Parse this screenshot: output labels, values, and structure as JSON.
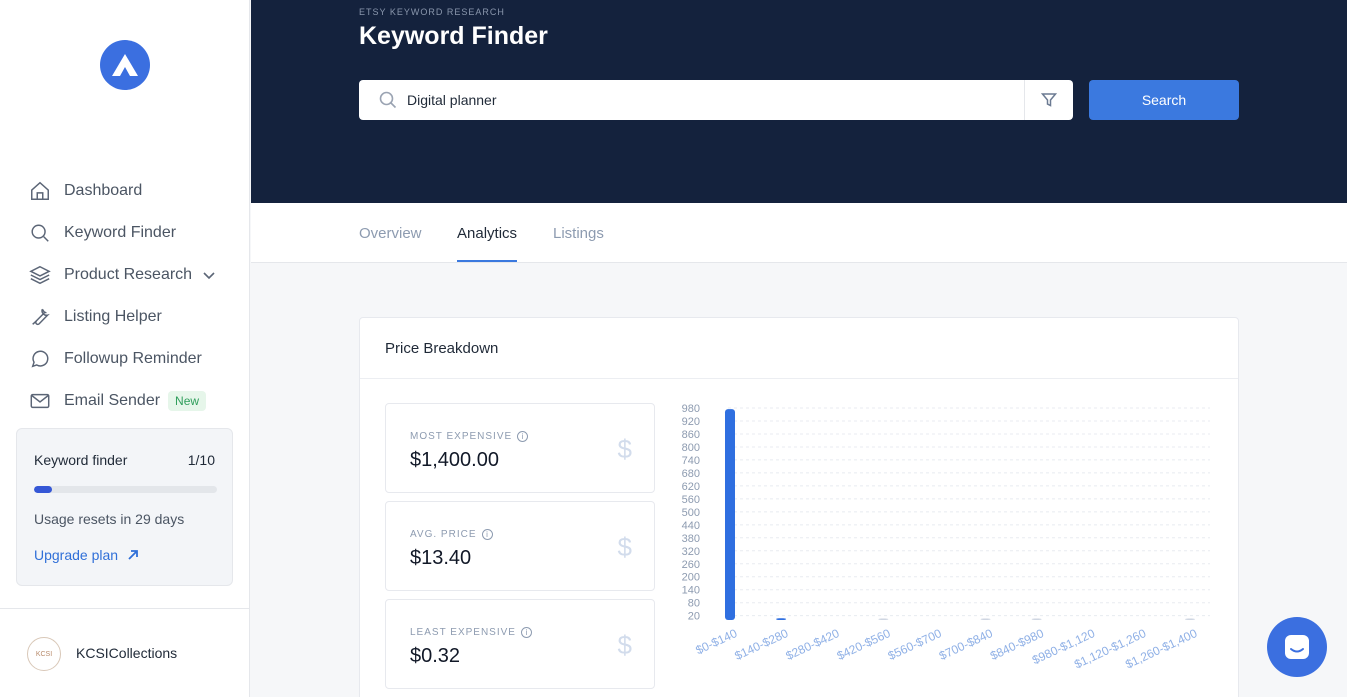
{
  "sidebar": {
    "items": [
      {
        "label": "Dashboard",
        "icon": "home-icon"
      },
      {
        "label": "Keyword Finder",
        "icon": "search-icon"
      },
      {
        "label": "Product Research",
        "icon": "layers-icon"
      },
      {
        "label": "Listing Helper",
        "icon": "wrench-icon"
      },
      {
        "label": "Followup Reminder",
        "icon": "chat-icon"
      },
      {
        "label": "Email Sender",
        "icon": "mail-icon",
        "badge": "New"
      }
    ],
    "usage": {
      "title": "Keyword finder",
      "count": "1/10",
      "progress": 0.1,
      "reset_text": "Usage resets in 29 days",
      "upgrade_label": "Upgrade plan"
    },
    "account": {
      "name": "KCSICollections",
      "avatar_text": "KCSI"
    }
  },
  "header": {
    "eyebrow": "ETSY KEYWORD RESEARCH",
    "title": "Keyword Finder",
    "search_value": "Digital planner",
    "search_button": "Search"
  },
  "tabs": [
    {
      "label": "Overview",
      "active": false
    },
    {
      "label": "Analytics",
      "active": true
    },
    {
      "label": "Listings",
      "active": false
    }
  ],
  "card": {
    "title": "Price Breakdown",
    "stats": [
      {
        "label": "MOST EXPENSIVE",
        "value": "$1,400.00"
      },
      {
        "label": "AVG. PRICE",
        "value": "$13.40"
      },
      {
        "label": "LEAST EXPENSIVE",
        "value": "$0.32"
      }
    ]
  },
  "colors": {
    "accent": "#3b79df",
    "header_bg": "#14223d",
    "bar": "#2f6fe0"
  },
  "chart_data": {
    "type": "bar",
    "categories": [
      "$0-$140",
      "$140-$280",
      "$280-$420",
      "$420-$560",
      "$560-$700",
      "$700-$840",
      "$840-$980",
      "$980-$1,120",
      "$1,120-$1,260",
      "$1,260-$1,400"
    ],
    "values": [
      975,
      8,
      0,
      1,
      0,
      1,
      1,
      0,
      0,
      1
    ],
    "yticks": [
      20,
      80,
      140,
      200,
      260,
      320,
      380,
      440,
      500,
      560,
      620,
      680,
      740,
      800,
      860,
      920,
      980
    ],
    "ylim": [
      0,
      980
    ],
    "grid": true
  }
}
